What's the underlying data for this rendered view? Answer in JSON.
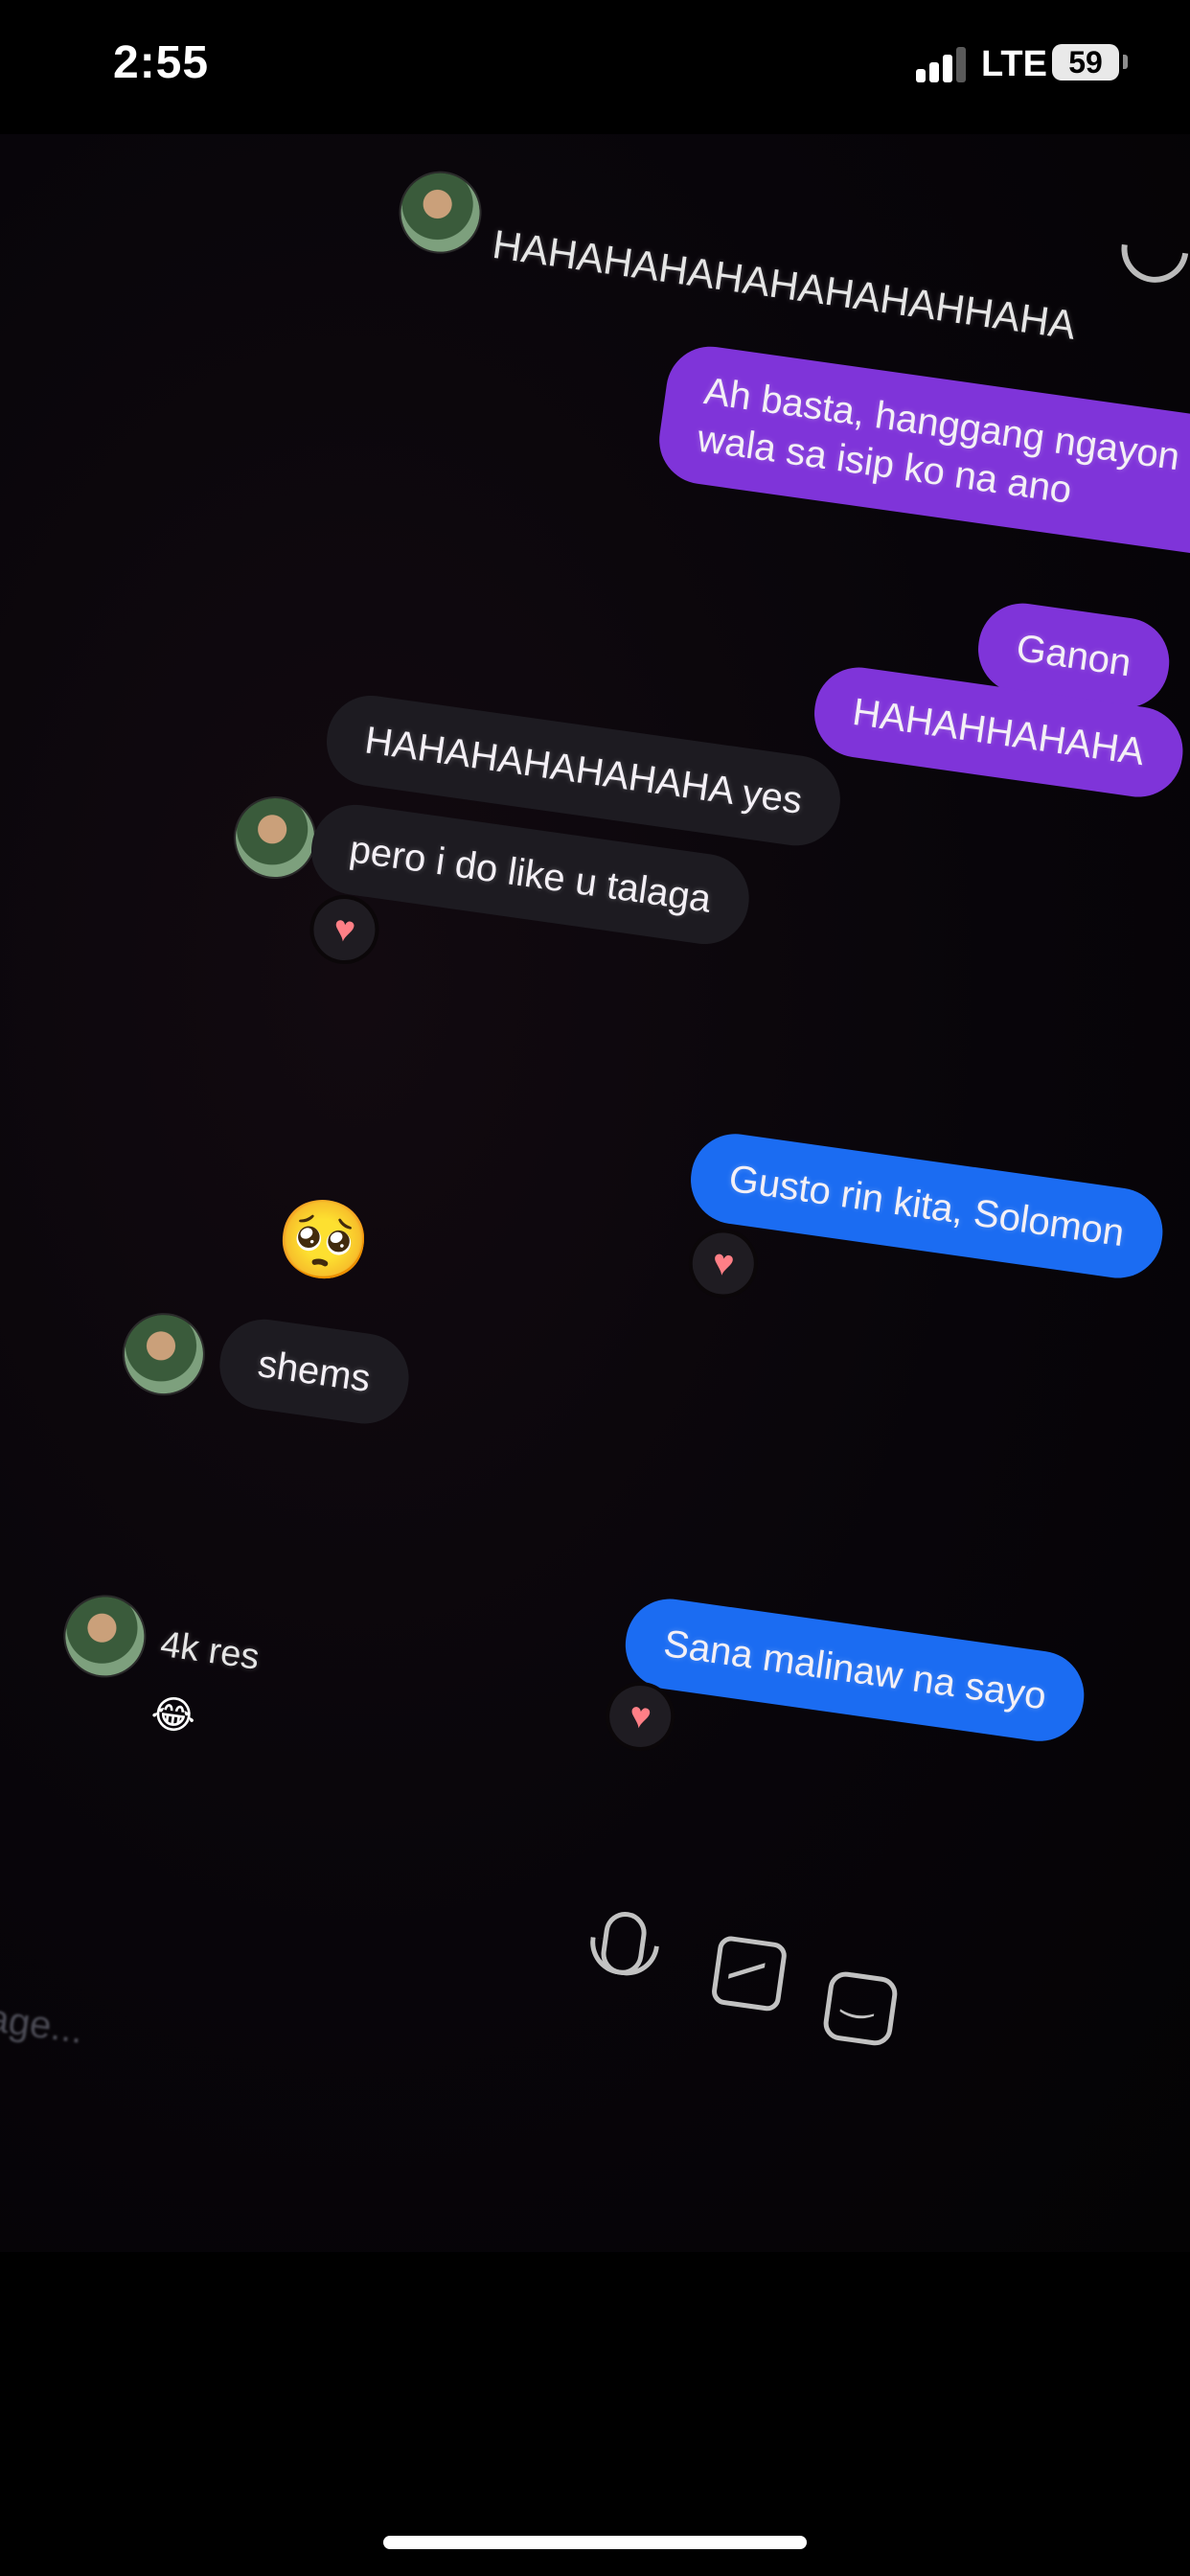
{
  "status_bar": {
    "time": "2:55",
    "network": "LTE",
    "battery": "59"
  },
  "messages": {
    "top_laugh": "HAHAHAHAHAHAHAHAHHAHA",
    "out1": "Ah basta, hanggang ngayon wala sa isip ko na ano",
    "out2": "Ganon",
    "out3": "HAHAHHAHAHA",
    "in1": "HAHAHAHAHAHAHA yes",
    "in2": "pero i do like u talaga",
    "out4": "Gusto rin kita, Solomon",
    "pleading_emoji": "🥺",
    "in3": "shems",
    "out5": "Sana malinaw na sayo",
    "in4": "4k res",
    "laugh_emoji": "😂"
  },
  "reactions": {
    "heart": "♥"
  },
  "composer": {
    "placeholder": "Message..."
  },
  "icons": {
    "call": "phone-icon",
    "mic": "microphone-icon",
    "gallery": "gallery-icon",
    "sticker": "sticker-icon",
    "camera": "camera-icon"
  },
  "colors": {
    "outgoing_purple": "#7f34d9",
    "outgoing_blue": "#1b6cf2",
    "incoming": "#1d1b21",
    "reaction_heart": "#ff7f86"
  }
}
